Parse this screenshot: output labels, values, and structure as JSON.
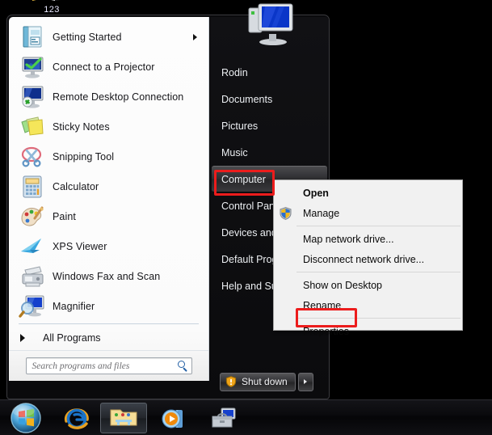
{
  "desktop": {
    "icon_label": "123",
    "icon_name": "flag-shortcut-icon"
  },
  "start_menu": {
    "programs": [
      {
        "label": "Getting Started",
        "icon": "getting-started-icon",
        "has_submenu": true
      },
      {
        "label": "Connect to a Projector",
        "icon": "projector-icon",
        "has_submenu": false
      },
      {
        "label": "Remote Desktop Connection",
        "icon": "remote-desktop-icon",
        "has_submenu": false
      },
      {
        "label": "Sticky Notes",
        "icon": "sticky-notes-icon",
        "has_submenu": false
      },
      {
        "label": "Snipping Tool",
        "icon": "snipping-tool-icon",
        "has_submenu": false
      },
      {
        "label": "Calculator",
        "icon": "calculator-icon",
        "has_submenu": false
      },
      {
        "label": "Paint",
        "icon": "paint-icon",
        "has_submenu": false
      },
      {
        "label": "XPS Viewer",
        "icon": "xps-viewer-icon",
        "has_submenu": false
      },
      {
        "label": "Windows Fax and Scan",
        "icon": "fax-scan-icon",
        "has_submenu": false
      },
      {
        "label": "Magnifier",
        "icon": "magnifier-icon",
        "has_submenu": false
      }
    ],
    "all_programs_label": "All Programs",
    "search": {
      "placeholder": "Search programs and files",
      "value": "",
      "icon": "search-icon"
    },
    "avatar_icon": "computer-monitor-avatar",
    "places": [
      {
        "label": "Rodin",
        "selected": false
      },
      {
        "label": "Documents",
        "selected": false
      },
      {
        "label": "Pictures",
        "selected": false
      },
      {
        "label": "Music",
        "selected": false
      },
      {
        "label": "Computer",
        "selected": true
      },
      {
        "label": "Control Panel",
        "selected": false
      },
      {
        "label": "Devices and Printers",
        "selected": false
      },
      {
        "label": "Default Programs",
        "selected": false
      },
      {
        "label": "Help and Support",
        "selected": false
      }
    ],
    "shutdown": {
      "label": "Shut down",
      "icon": "power-shield-icon",
      "arrow_icon": "chevron-right-icon"
    }
  },
  "context_menu": {
    "groups": [
      [
        {
          "label": "Open",
          "bold": true,
          "shield": false
        },
        {
          "label": "Manage",
          "bold": false,
          "shield": true
        }
      ],
      [
        {
          "label": "Map network drive...",
          "bold": false,
          "shield": false
        },
        {
          "label": "Disconnect network drive...",
          "bold": false,
          "shield": false
        }
      ],
      [
        {
          "label": "Show on Desktop",
          "bold": false,
          "shield": false
        },
        {
          "label": "Rename",
          "bold": false,
          "shield": false
        }
      ],
      [
        {
          "label": "Properties",
          "bold": false,
          "shield": false
        }
      ]
    ]
  },
  "taskbar": {
    "start_orb_icon": "windows-start-orb",
    "buttons": [
      {
        "icon": "internet-explorer-icon",
        "active": false
      },
      {
        "icon": "windows-explorer-icon",
        "active": true
      },
      {
        "icon": "windows-media-player-icon",
        "active": false
      },
      {
        "icon": "toolbox-computer-icon",
        "active": false
      }
    ]
  },
  "annotations": {
    "accent_color": "#ec1c1c",
    "boxes": [
      {
        "target": "Computer"
      },
      {
        "target": "Properties"
      },
      {
        "target": "Start"
      }
    ]
  }
}
